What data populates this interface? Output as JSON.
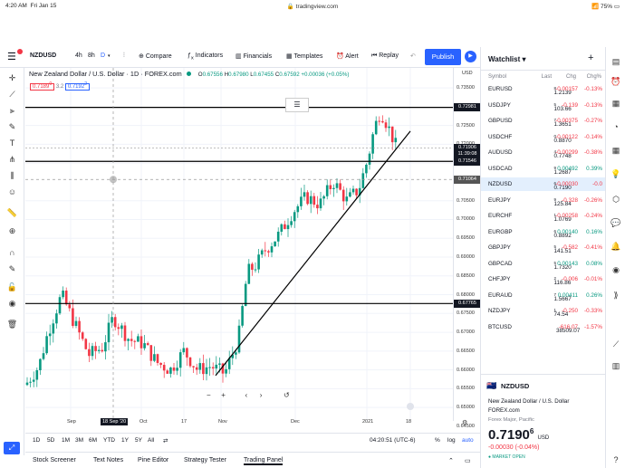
{
  "status": {
    "time": "4:20 AM",
    "date": "Fri Jan 15",
    "url": "tradingview.com",
    "battery": "75%"
  },
  "toolbar": {
    "symbol": "NZDUSD",
    "intervals": [
      "4h",
      "8h",
      "D"
    ],
    "compare": "Compare",
    "indicators": "Indicators",
    "financials": "Financials",
    "templates": "Templates",
    "alert": "Alert",
    "replay": "Replay",
    "publish": "Publish"
  },
  "legend": {
    "title": "New Zealand Dollar / U.S. Dollar · 1D · FOREX.com",
    "o": "0.67556",
    "h": "0.67980",
    "l": "0.67455",
    "c": "0.67592",
    "chg": "+0.00036 (+0.05%)",
    "o_label": "O",
    "h_label": "H",
    "l_label": "L",
    "c_label": "C",
    "bid": "0.7189",
    "bid_sup": "0",
    "spread": "3.2",
    "ask": "0.7192",
    "ask_sup": "2"
  },
  "chart": {
    "date_label": "18 Sep '20",
    "price_labels": [
      "0.73500",
      "0.72500",
      "0.72000",
      "0.71500",
      "0.70500",
      "0.70000",
      "0.69500",
      "0.69000",
      "0.68500",
      "0.68000",
      "0.67500",
      "0.67000",
      "0.66500",
      "0.66000",
      "0.65500",
      "0.65000",
      "0.64500"
    ],
    "tags": {
      "line_top": "0.72981",
      "current": "0.71906",
      "countdown": "11:39:08",
      "line_mid": "0.71546",
      "crosshair": "0.71064",
      "line_bot": "0.67765"
    },
    "currency": "USD",
    "time_labels": [
      "Sep",
      "Oct",
      "17",
      "Nov",
      "Dec",
      "2021",
      "18"
    ]
  },
  "rangebar": {
    "ranges": [
      "1D",
      "5D",
      "1M",
      "3M",
      "6M",
      "YTD",
      "1Y",
      "5Y",
      "All"
    ],
    "clock": "04:20:51 (UTC-6)",
    "pct": "%",
    "log": "log",
    "auto": "auto"
  },
  "bottomtabs": [
    "Stock Screener",
    "Text Notes",
    "Pine Editor",
    "Strategy Tester",
    "Trading Panel"
  ],
  "watchlist": {
    "title": "Watchlist",
    "headers": {
      "symbol": "Symbol",
      "last": "Last",
      "chg": "Chg",
      "chgp": "Chg%"
    },
    "rows": [
      {
        "s": "EURUSD",
        "p": "1.2139",
        "ps": "8",
        "c": "-0.00157",
        "cp": "-0.13%",
        "neg": true
      },
      {
        "s": "USDJPY",
        "p": "103.66",
        "ps": "5",
        "c": "-0.139",
        "cp": "-0.13%",
        "neg": true
      },
      {
        "s": "GBPUSD",
        "p": "1.3651",
        "ps": "7",
        "c": "-0.00375",
        "cp": "-0.27%",
        "neg": true
      },
      {
        "s": "USDCHF",
        "p": "0.8870",
        "ps": "0",
        "c": "-0.00122",
        "cp": "-0.14%",
        "neg": true
      },
      {
        "s": "AUDUSD",
        "p": "0.7748",
        "ps": "4",
        "c": "-0.00299",
        "cp": "-0.38%",
        "neg": true
      },
      {
        "s": "USDCAD",
        "p": "1.2687",
        "ps": "9",
        "c": "0.00492",
        "cp": "0.39%",
        "neg": false
      },
      {
        "s": "NZDUSD",
        "p": "0.7190",
        "ps": "6",
        "c": "-0.00030",
        "cp": "-0.0",
        "neg": true
      },
      {
        "s": "EURJPY",
        "p": "125.84",
        "ps": "9",
        "c": "-0.328",
        "cp": "-0.26%",
        "neg": true
      },
      {
        "s": "EURCHF",
        "p": "1.0769",
        "ps": "1",
        "c": "-0.00258",
        "cp": "-0.24%",
        "neg": true
      },
      {
        "s": "EURGBP",
        "p": "0.8892",
        "ps": "6",
        "c": "0.00140",
        "cp": "0.16%",
        "neg": false
      },
      {
        "s": "GBPJPY",
        "p": "141.51",
        "ps": "5",
        "c": "-0.582",
        "cp": "-0.41%",
        "neg": true
      },
      {
        "s": "GBPCAD",
        "p": "1.7320",
        "ps": "5",
        "c": "0.00143",
        "cp": "0.08%",
        "neg": false
      },
      {
        "s": "CHFJPY",
        "p": "116.86",
        "ps": "2",
        "c": "-0.006",
        "cp": "-0.01%",
        "neg": true
      },
      {
        "s": "EURAUD",
        "p": "1.5667",
        "ps": "7",
        "c": "0.00411",
        "cp": "0.26%",
        "neg": false
      },
      {
        "s": "NZDJPY",
        "p": "74.54",
        "ps": "1",
        "c": "-0.250",
        "cp": "-0.33%",
        "neg": true
      },
      {
        "s": "BTCUSD",
        "p": "38509.07",
        "ps": "",
        "c": "-616.07",
        "cp": "-1.57%",
        "neg": true
      }
    ]
  },
  "detail": {
    "symbol": "NZDUSD",
    "name": "New Zealand Dollar / U.S. Dollar",
    "exchange": "FOREX.com",
    "category": "Forex Major, Pacific",
    "price": "0.7190",
    "price_sup": "6",
    "currency": "USD",
    "change": "-0.00030 (-0.04%)",
    "market": "MARKET OPEN"
  },
  "colors": {
    "up": "#089981",
    "down": "#f23645",
    "accent": "#2962ff"
  }
}
